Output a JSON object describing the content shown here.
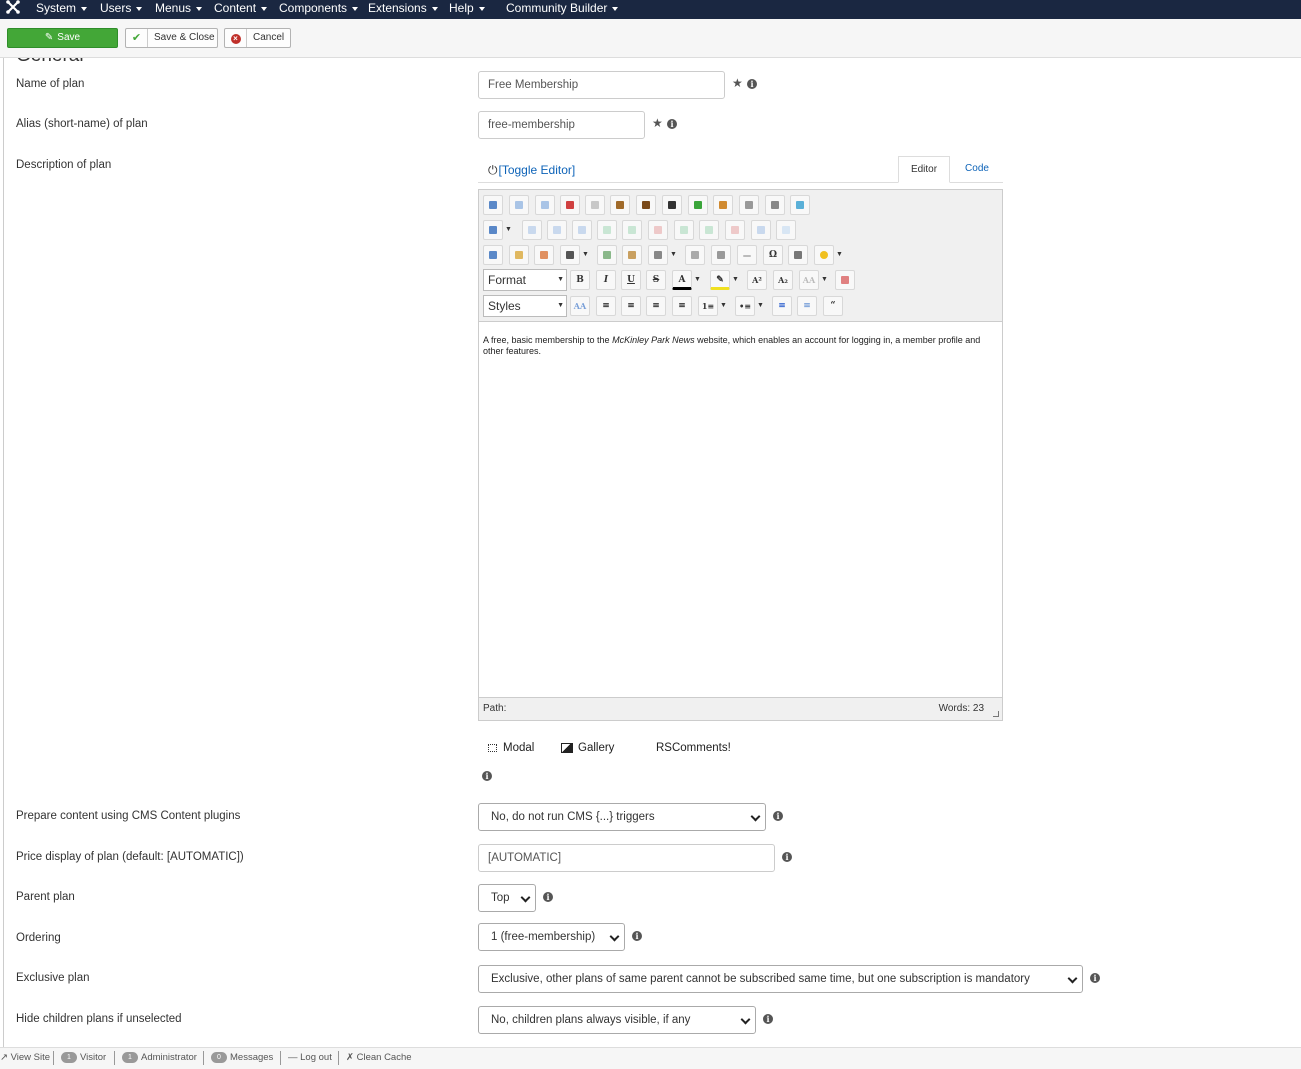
{
  "topnav": {
    "menus": [
      "System",
      "Users",
      "Menus",
      "Content",
      "Components",
      "Extensions",
      "Help",
      "Community Builder"
    ]
  },
  "toolbar": {
    "save_label": "Save",
    "save_close_label": "Save & Close",
    "cancel_label": "Cancel"
  },
  "form": {
    "legend": "General",
    "name": {
      "label": "Name of plan",
      "value": "Free Membership"
    },
    "alias": {
      "label": "Alias (short-name) of plan",
      "value": "free-membership"
    },
    "description": {
      "label": "Description of plan"
    },
    "prepare": {
      "label": "Prepare content using CMS Content plugins",
      "value": "No, do not run CMS {...} triggers"
    },
    "price": {
      "label": "Price display of plan (default: [AUTOMATIC])",
      "value": "[AUTOMATIC]"
    },
    "parent": {
      "label": "Parent plan",
      "value": "Top"
    },
    "ordering": {
      "label": "Ordering",
      "value": "1 (free-membership)"
    },
    "exclusive": {
      "label": "Exclusive plan",
      "value": "Exclusive, other plans of same parent cannot be subscribed same time, but one subscription is mandatory"
    },
    "hide": {
      "label": "Hide children plans if unselected",
      "value": "No, children plans always visible, if any"
    }
  },
  "editor": {
    "toggle_label": "[Toggle Editor]",
    "tab_editor": "Editor",
    "tab_code": "Code",
    "format_label": "Format",
    "styles_label": "Styles",
    "body_before": "A free, basic membership to the ",
    "body_em": "McKinley Park News",
    "body_after": " website, which enables an account for logging in, a member profile and other features.",
    "path_label": "Path:",
    "words_label": "Words: 23",
    "plugins": {
      "modal": "Modal",
      "gallery": "Gallery",
      "rscomments": "RSComments!"
    }
  },
  "statusbar": {
    "view_site": "View Site",
    "visitor_count": "1",
    "visitor_label": "Visitor",
    "admin_count": "1",
    "admin_label": "Administrator",
    "messages_count": "0",
    "messages_label": "Messages",
    "logout_label": "Log out",
    "clean_cache_label": "Clean Cache"
  },
  "colors": {
    "nav_bg": "#1a2741",
    "save_green": "#43a737",
    "link_blue": "#0d63b8"
  }
}
